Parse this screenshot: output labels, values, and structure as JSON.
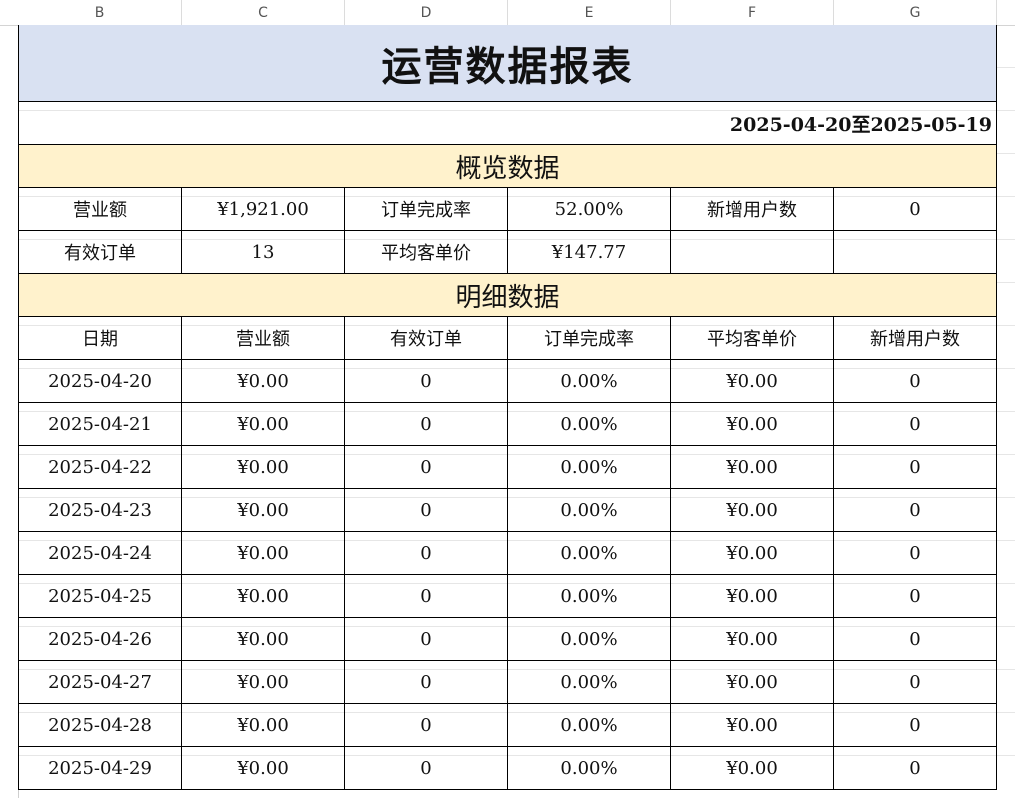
{
  "columns": [
    "B",
    "C",
    "D",
    "E",
    "F",
    "G"
  ],
  "report": {
    "title": "运营数据报表",
    "date_range": "2025-04-20至2025-05-19",
    "overview_title": "概览数据",
    "overview_rows": [
      [
        "营业额",
        "¥1,921.00",
        "订单完成率",
        "52.00%",
        "新增用户数",
        "0"
      ],
      [
        "有效订单",
        "13",
        "平均客单价",
        "¥147.77",
        "",
        ""
      ]
    ],
    "detail_title": "明细数据",
    "detail_headers": [
      "日期",
      "营业额",
      "有效订单",
      "订单完成率",
      "平均客单价",
      "新增用户数"
    ],
    "detail_rows": [
      [
        "2025-04-20",
        "¥0.00",
        "0",
        "0.00%",
        "¥0.00",
        "0"
      ],
      [
        "2025-04-21",
        "¥0.00",
        "0",
        "0.00%",
        "¥0.00",
        "0"
      ],
      [
        "2025-04-22",
        "¥0.00",
        "0",
        "0.00%",
        "¥0.00",
        "0"
      ],
      [
        "2025-04-23",
        "¥0.00",
        "0",
        "0.00%",
        "¥0.00",
        "0"
      ],
      [
        "2025-04-24",
        "¥0.00",
        "0",
        "0.00%",
        "¥0.00",
        "0"
      ],
      [
        "2025-04-25",
        "¥0.00",
        "0",
        "0.00%",
        "¥0.00",
        "0"
      ],
      [
        "2025-04-26",
        "¥0.00",
        "0",
        "0.00%",
        "¥0.00",
        "0"
      ],
      [
        "2025-04-27",
        "¥0.00",
        "0",
        "0.00%",
        "¥0.00",
        "0"
      ],
      [
        "2025-04-28",
        "¥0.00",
        "0",
        "0.00%",
        "¥0.00",
        "0"
      ],
      [
        "2025-04-29",
        "¥0.00",
        "0",
        "0.00%",
        "¥0.00",
        "0"
      ]
    ]
  }
}
